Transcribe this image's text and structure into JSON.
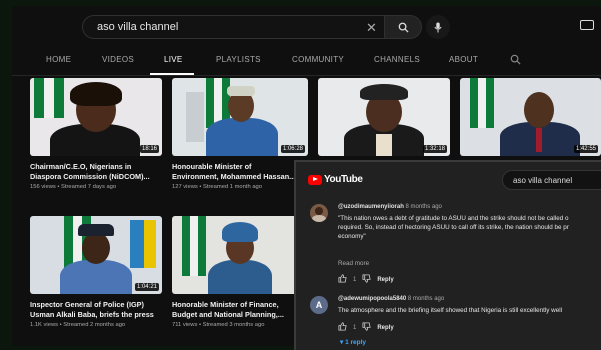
{
  "search": {
    "query": "aso villa channel"
  },
  "nav": {
    "tabs": [
      "HOME",
      "VIDEOS",
      "LIVE",
      "PLAYLISTS",
      "COMMUNITY",
      "CHANNELS",
      "ABOUT"
    ],
    "active_tab": "LIVE"
  },
  "videos": [
    {
      "title_line1": "Chairman/C.E.O, Nigerians in",
      "title_line2": "Diaspora Commission (NiDCOM)...",
      "meta": "156 views • Streamed 7 days ago",
      "duration": "18:16"
    },
    {
      "title_line1": "Honourable Minister of",
      "title_line2": "Environment, Mohammed Hassan...",
      "meta": "127 views • Streamed 1 month ago",
      "duration": "1:06:28"
    },
    {
      "duration": "1:32:18"
    },
    {
      "duration": "1:42:55"
    },
    {
      "title_line1": "Inspector General of Police (IGP)",
      "title_line2": "Usman Alkali Baba, briefs the press",
      "meta": "1.1K views • Streamed 2 months ago",
      "duration": "1:04:21"
    },
    {
      "title_line1": "Honorable Minister of Finance,",
      "title_line2": "Budget and National Planning,...",
      "meta": "711 views • Streamed 3 months ago"
    }
  ],
  "overlay": {
    "logo_text": "YouTube",
    "search_query": "aso villa channel",
    "comments": [
      {
        "author": "@uzodimaumenyiiorah",
        "time": "8 months ago",
        "text_line1": "\"This nation owes a debt of gratitude to ASUU and the strike should not be called o",
        "text_line2": "required. So, instead of hectoring ASUU to call off its strike, the nation should be pr",
        "text_line3": "economy\"",
        "read_more": "Read more",
        "likes": "1",
        "reply_label": "Reply"
      },
      {
        "author": "@adewumipopoola5840",
        "time": "8 months ago",
        "avatar_letter": "A",
        "text_line1": "The atmosphere and the briefing itself showed that Nigeria is still excellently well",
        "likes": "1",
        "reply_label": "Reply",
        "replies_link": "1 reply"
      }
    ]
  },
  "colors": {
    "brand_red": "#ff0000",
    "link_blue": "#3ea6ff",
    "flag_green": "#0d7a3a"
  }
}
